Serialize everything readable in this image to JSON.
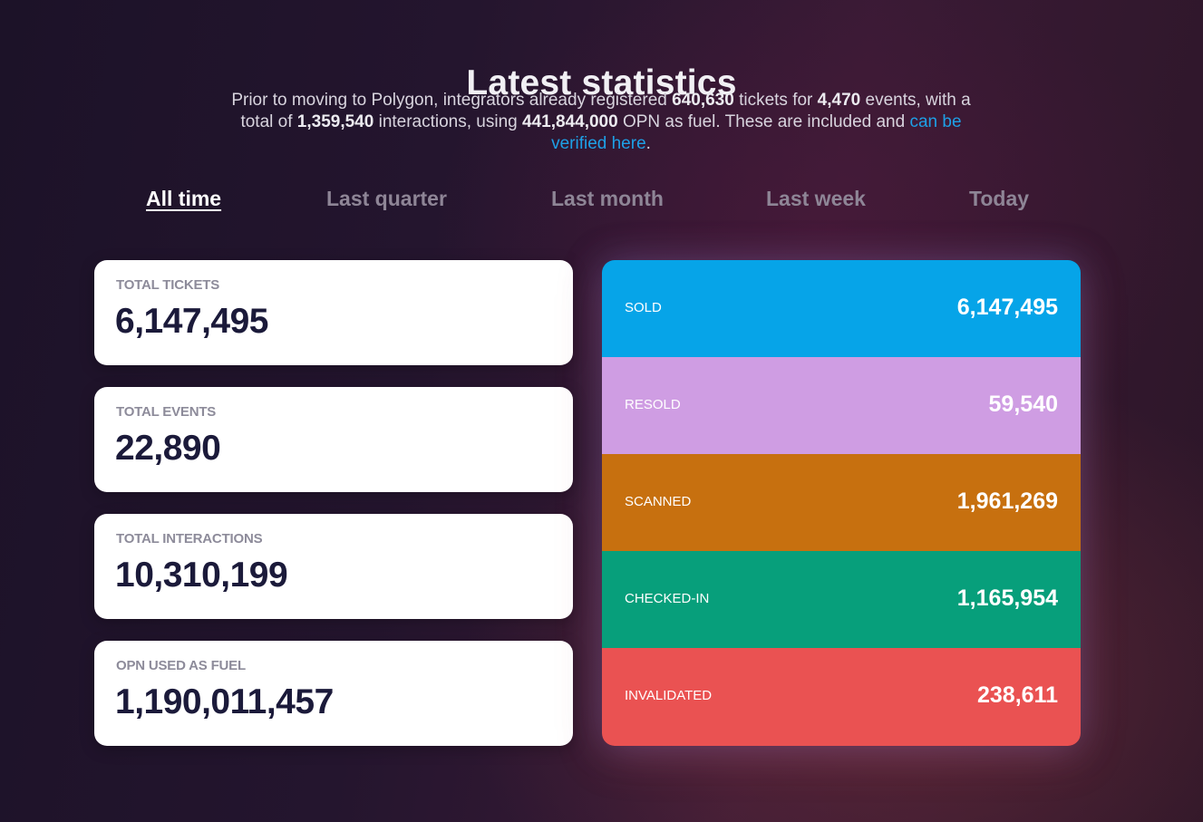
{
  "header": {
    "title": "Latest statistics",
    "intro": {
      "t1": "Prior to moving to Polygon, integrators already registered ",
      "tickets": "640,630",
      "t2": " tickets for ",
      "events": "4,470",
      "t3": " events, with a total of ",
      "interactions": "1,359,540",
      "t4": " interactions, using ",
      "fuel": "441,844,000",
      "t5": " OPN as fuel. These are included and ",
      "link": "can be verified here",
      "t6": "."
    }
  },
  "tabs": [
    {
      "label": "All time",
      "active": true
    },
    {
      "label": "Last quarter",
      "active": false
    },
    {
      "label": "Last month",
      "active": false
    },
    {
      "label": "Last week",
      "active": false
    },
    {
      "label": "Today",
      "active": false
    }
  ],
  "cards": [
    {
      "label": "TOTAL TICKETS",
      "value": "6,147,495"
    },
    {
      "label": "TOTAL EVENTS",
      "value": "22,890"
    },
    {
      "label": "TOTAL INTERACTIONS",
      "value": "10,310,199"
    },
    {
      "label": "OPN USED AS FUEL",
      "value": "1,190,011,457"
    }
  ],
  "breakdown": [
    {
      "label": "SOLD",
      "value": "6,147,495",
      "color": "#06a4e8"
    },
    {
      "label": "RESOLD",
      "value": "59,540",
      "color": "#cf9de3"
    },
    {
      "label": "SCANNED",
      "value": "1,961,269",
      "color": "#c7700f"
    },
    {
      "label": "CHECKED-IN",
      "value": "1,165,954",
      "color": "#079f7b"
    },
    {
      "label": "INVALIDATED",
      "value": "238,611",
      "color": "#ea5252"
    }
  ]
}
